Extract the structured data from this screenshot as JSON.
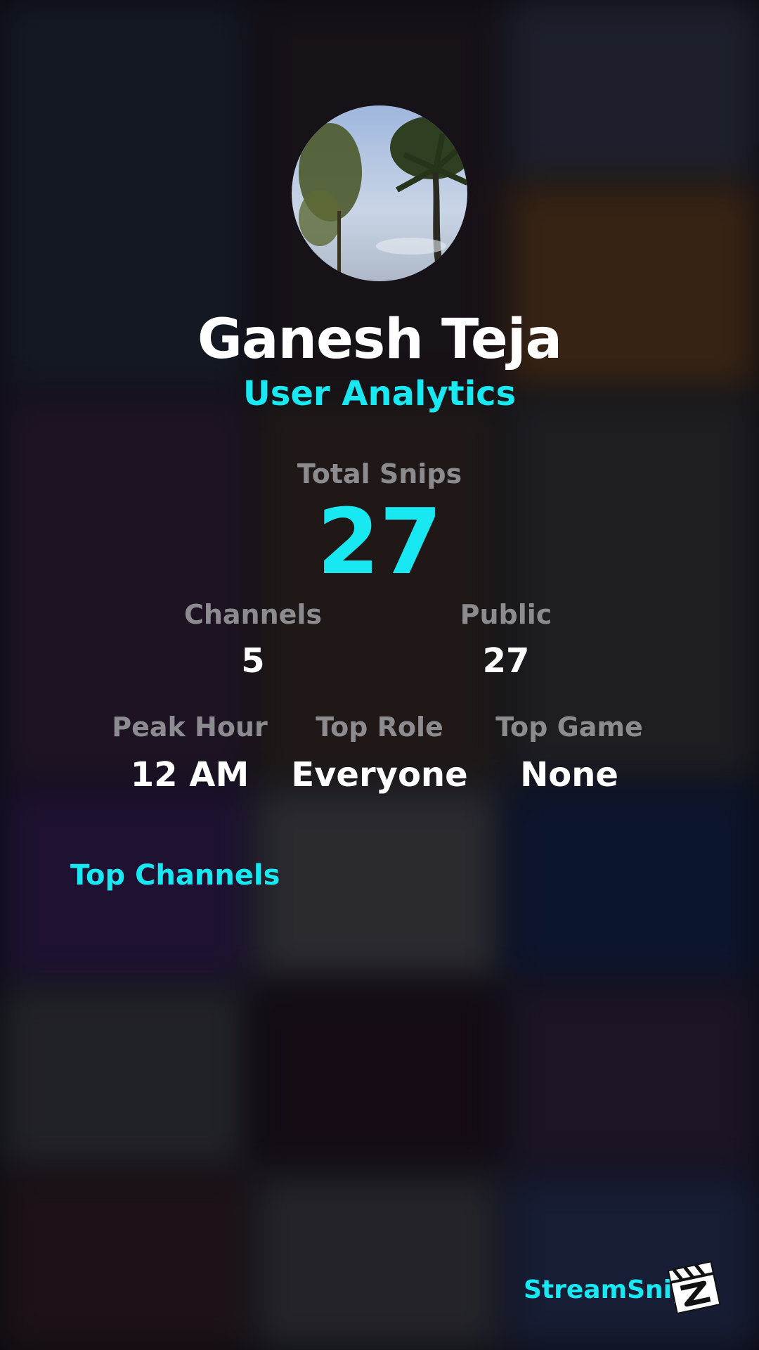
{
  "profile": {
    "name": "Ganesh Teja",
    "subtitle": "User Analytics"
  },
  "total": {
    "label": "Total Snips",
    "value": "27"
  },
  "row1": [
    {
      "label": "Channels",
      "value": "5"
    },
    {
      "label": "Public",
      "value": "27"
    }
  ],
  "row2": [
    {
      "label": "Peak Hour",
      "value": "12 AM"
    },
    {
      "label": "Top Role",
      "value": "Everyone"
    },
    {
      "label": "Top Game",
      "value": "None"
    }
  ],
  "sections": {
    "top_channels": "Top Channels"
  },
  "brand": {
    "name": "StreamSnip",
    "logo_icon": "clapperboard-icon"
  },
  "colors": {
    "accent": "#17e8f2",
    "label": "#8c8c90",
    "text": "#ffffff"
  }
}
